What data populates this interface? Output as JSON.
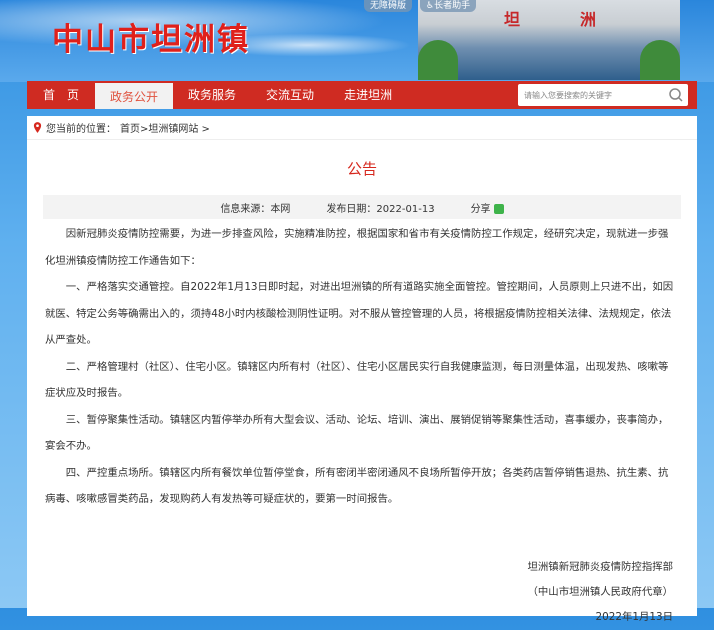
{
  "header": {
    "site_title": "中山市坦洲镇",
    "accessibility_label": "无障碍版",
    "elderly_label": "长者助手",
    "building_chars": [
      "坦",
      "洲"
    ]
  },
  "nav": {
    "items": [
      "首　页",
      "政务公开",
      "政务服务",
      "交流互动",
      "走进坦洲"
    ],
    "active_index": 1,
    "search_placeholder": "请输入您要搜索的关键字"
  },
  "breadcrumb": {
    "prefix": "您当前的位置：",
    "path": "首页>坦洲镇网站 >"
  },
  "article": {
    "title": "公告",
    "source": "信息来源：本网",
    "date": "发布日期：2022-01-13",
    "share": "分享",
    "paragraphs": [
      "因新冠肺炎疫情防控需要，为进一步排查风险，实施精准防控，根据国家和省市有关疫情防控工作规定，经研究决定，现就进一步强化坦洲镇疫情防控工作通告如下：",
      "一、严格落实交通管控。自2022年1月13日即时起，对进出坦洲镇的所有道路实施全面管控。管控期间，人员原则上只进不出，如因就医、特定公务等确需出入的，须持48小时内核酸检测阴性证明。对不服从管控管理的人员，将根据疫情防控相关法律、法规规定，依法从严查处。",
      "二、严格管理村（社区）、住宅小区。镇辖区内所有村（社区）、住宅小区居民实行自我健康监测，每日测量体温，出现发热、咳嗽等症状应及时报告。",
      "三、暂停聚集性活动。镇辖区内暂停举办所有大型会议、活动、论坛、培训、演出、展销促销等聚集性活动，喜事缓办，丧事简办，宴会不办。",
      "四、严控重点场所。镇辖区内所有餐饮单位暂停堂食，所有密闭半密闭通风不良场所暂停开放；各类药店暂停销售退热、抗生素、抗病毒、咳嗽感冒类药品，发现购药人有发热等可疑症状的，要第一时间报告。"
    ],
    "signature": [
      "坦洲镇新冠肺炎疫情防控指挥部",
      "（中山市坦洲镇人民政府代章）",
      "2022年1月13日"
    ]
  }
}
